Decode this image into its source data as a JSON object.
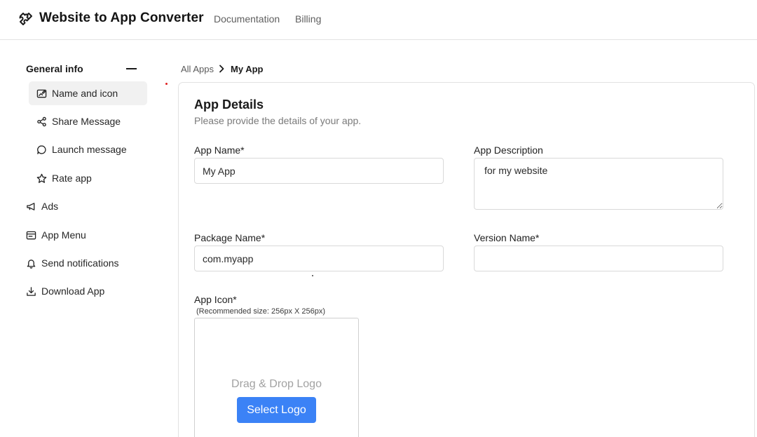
{
  "header": {
    "title": "Website to App Converter",
    "logo_icon": "puzzle-icon",
    "nav": [
      "Documentation",
      "Billing"
    ]
  },
  "sidebar": {
    "section_label": "General info",
    "section_toggle_icon": "minus-icon",
    "sub_items": [
      {
        "label": "Name and icon",
        "icon": "image-edit-icon",
        "active": true
      },
      {
        "label": "Share Message",
        "icon": "share-icon"
      },
      {
        "label": "Launch message",
        "icon": "chat-bubble-icon"
      },
      {
        "label": "Rate app",
        "icon": "star-icon"
      }
    ],
    "items": [
      {
        "label": "Ads",
        "icon": "megaphone-icon"
      },
      {
        "label": "App Menu",
        "icon": "menu-card-icon"
      },
      {
        "label": "Send notifications",
        "icon": "bell-icon"
      },
      {
        "label": "Download App",
        "icon": "download-icon"
      }
    ]
  },
  "breadcrumb": {
    "root": "All Apps",
    "separator_icon": "chevron-right-icon",
    "current": "My App"
  },
  "card": {
    "title": "App Details",
    "subtitle": "Please provide the details of your app.",
    "fields": {
      "app_name": {
        "label": "App Name*",
        "value": "My App"
      },
      "app_description": {
        "label": "App Description",
        "value": "for my website"
      },
      "package_name": {
        "label": "Package Name*",
        "value": "com.myapp"
      },
      "version_name": {
        "label": "Version Name*",
        "value": ""
      }
    },
    "app_icon": {
      "label": "App Icon*",
      "hint": "(Recommended size: 256px X 256px)",
      "drop_text": "Drag & Drop Logo",
      "button_label": "Select Logo"
    }
  },
  "colors": {
    "accent": "#3b82f6",
    "active_item_bg": "#f1f1f1"
  }
}
